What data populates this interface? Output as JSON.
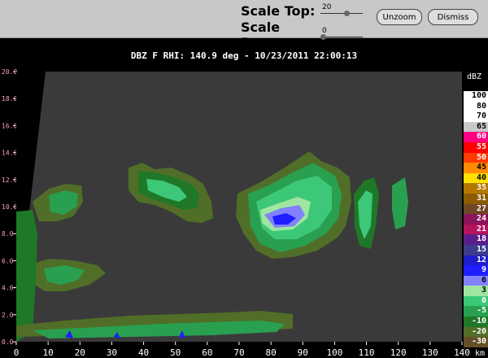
{
  "toolbar": {
    "scale_top_label": "Scale Top:",
    "scale_top_value": "20",
    "scale_top_fraction": 0.65,
    "scale_base_label": "Scale Base:",
    "scale_base_value": "0",
    "scale_base_fraction": 0.0,
    "unzoom_label": "Unzoom",
    "dismiss_label": "Dismiss"
  },
  "plot": {
    "title": "DBZ F  RHI: 140.9 deg  -  10/23/2011 22:00:13",
    "x_ticks": [
      "0",
      "10",
      "20",
      "30",
      "40",
      "50",
      "60",
      "70",
      "80",
      "90",
      "100",
      "110",
      "120",
      "130",
      "140"
    ],
    "x_unit": "km",
    "y_ticks": [
      "0.0",
      "2.0",
      "4.0",
      "6.0",
      "8.0",
      "10.0",
      "12.0",
      "14.0",
      "16.0",
      "18.0",
      "20.0"
    ],
    "corner_left": "1",
    "corner_right": "2",
    "background_color": "#3a3a3a",
    "blanked_color": "#000000"
  },
  "colorbar": {
    "unit": "dBZ",
    "entries": [
      {
        "label": "100",
        "color": "#ffffff"
      },
      {
        "label": "80",
        "color": "#ffffff"
      },
      {
        "label": "70",
        "color": "#ffffff"
      },
      {
        "label": "65",
        "color": "#c8c8c8"
      },
      {
        "label": "60",
        "color": "#ff0080"
      },
      {
        "label": "55",
        "color": "#ff0000"
      },
      {
        "label": "50",
        "color": "#ff3c00"
      },
      {
        "label": "45",
        "color": "#ff8c00"
      },
      {
        "label": "40",
        "color": "#ffe000"
      },
      {
        "label": "35",
        "color": "#b47800"
      },
      {
        "label": "31",
        "color": "#8c5a00"
      },
      {
        "label": "27",
        "color": "#6e4628"
      },
      {
        "label": "24",
        "color": "#8c145a"
      },
      {
        "label": "21",
        "color": "#b4145a"
      },
      {
        "label": "18",
        "color": "#5a1e8c"
      },
      {
        "label": "15",
        "color": "#3c3c8c"
      },
      {
        "label": "12",
        "color": "#1e1ecc"
      },
      {
        "label": "9",
        "color": "#1e1eff"
      },
      {
        "label": "6",
        "color": "#8282ff"
      },
      {
        "label": "3",
        "color": "#a0e6a0"
      },
      {
        "label": "0",
        "color": "#3cc878"
      },
      {
        "label": "-5",
        "color": "#28a050"
      },
      {
        "label": "-10",
        "color": "#1e7828"
      },
      {
        "label": "-20",
        "color": "#506e28"
      },
      {
        "label": "-30",
        "color": "#645028"
      }
    ]
  }
}
